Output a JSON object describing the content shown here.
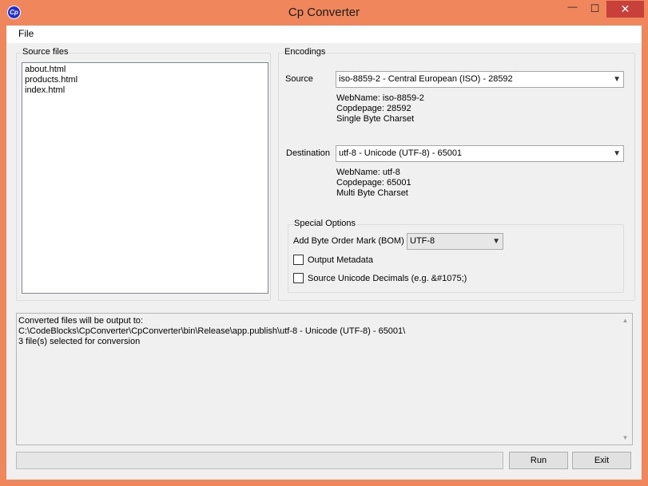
{
  "window": {
    "title": "Cp Converter",
    "icon_text": "Cp",
    "minimize_glyph": "—",
    "maximize_glyph": "☐",
    "close_glyph": "✕"
  },
  "menu": {
    "file": "File"
  },
  "source_files": {
    "legend": "Source files",
    "items": [
      "about.html",
      "products.html",
      "index.html"
    ]
  },
  "encodings": {
    "legend": "Encodings",
    "source": {
      "label": "Source",
      "selected": "iso-8859-2 - Central European (ISO) - 28592",
      "webname": "WebName: iso-8859-2",
      "codepage": "Copdepage: 28592",
      "charset": "Single Byte Charset"
    },
    "destination": {
      "label": "Destination",
      "selected": "utf-8 - Unicode (UTF-8) - 65001",
      "webname": "WebName: utf-8",
      "codepage": "Copdepage: 65001",
      "charset": "Multi Byte Charset"
    }
  },
  "special_options": {
    "legend": "Special Options",
    "bom_label": "Add Byte Order Mark (BOM)",
    "bom_selected": "UTF-8",
    "output_metadata": {
      "label": "Output Metadata",
      "checked": false
    },
    "unicode_decimals": {
      "label": "Source Unicode Decimals (e.g. &#1075;)",
      "checked": false
    }
  },
  "output_log": [
    "Converted files will be output to:",
    "C:\\CodeBlocks\\CpConverter\\CpConverter\\bin\\Release\\app.publish\\utf-8 - Unicode (UTF-8) - 65001\\",
    "3 file(s) selected for conversion"
  ],
  "progress": {
    "value": 0
  },
  "buttons": {
    "run": "Run",
    "exit": "Exit"
  },
  "colors": {
    "window_frame": "#f0865c",
    "close_button": "#c7403a",
    "app_icon": "#1a2fd9"
  },
  "icons": {
    "app": "cp-logo-icon",
    "dropdown": "chevron-down-icon",
    "scroll_up": "arrow-up-icon",
    "scroll_down": "arrow-down-icon"
  }
}
